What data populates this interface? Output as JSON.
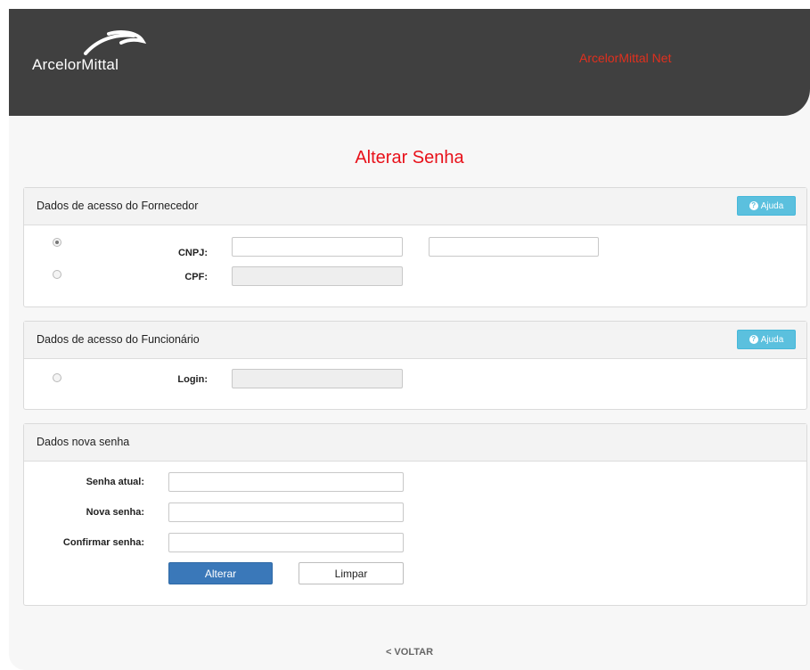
{
  "header": {
    "logo_text": "ArcelorMittal",
    "net_link": "ArcelorMittal Net"
  },
  "page_title": "Alterar Senha",
  "fornecedor": {
    "title": "Dados de acesso do Fornecedor",
    "help": "Ajuda",
    "cnpj_label": "CNPJ:",
    "cpf_label": "CPF:",
    "selected": "CNPJ"
  },
  "funcionario": {
    "title": "Dados de acesso do Funcionário",
    "help": "Ajuda",
    "login_label": "Login:"
  },
  "nova_senha": {
    "title": "Dados nova senha",
    "senha_atual_label": "Senha atual:",
    "nova_senha_label": "Nova senha:",
    "confirmar_label": "Confirmar senha:",
    "alterar_btn": "Alterar",
    "limpar_btn": "Limpar"
  },
  "footer": {
    "back_link": "< VOLTAR"
  },
  "colors": {
    "header_bg": "#404040",
    "accent_red": "#e8111a",
    "primary_blue": "#3a78b9",
    "info_blue": "#5bc0de"
  }
}
